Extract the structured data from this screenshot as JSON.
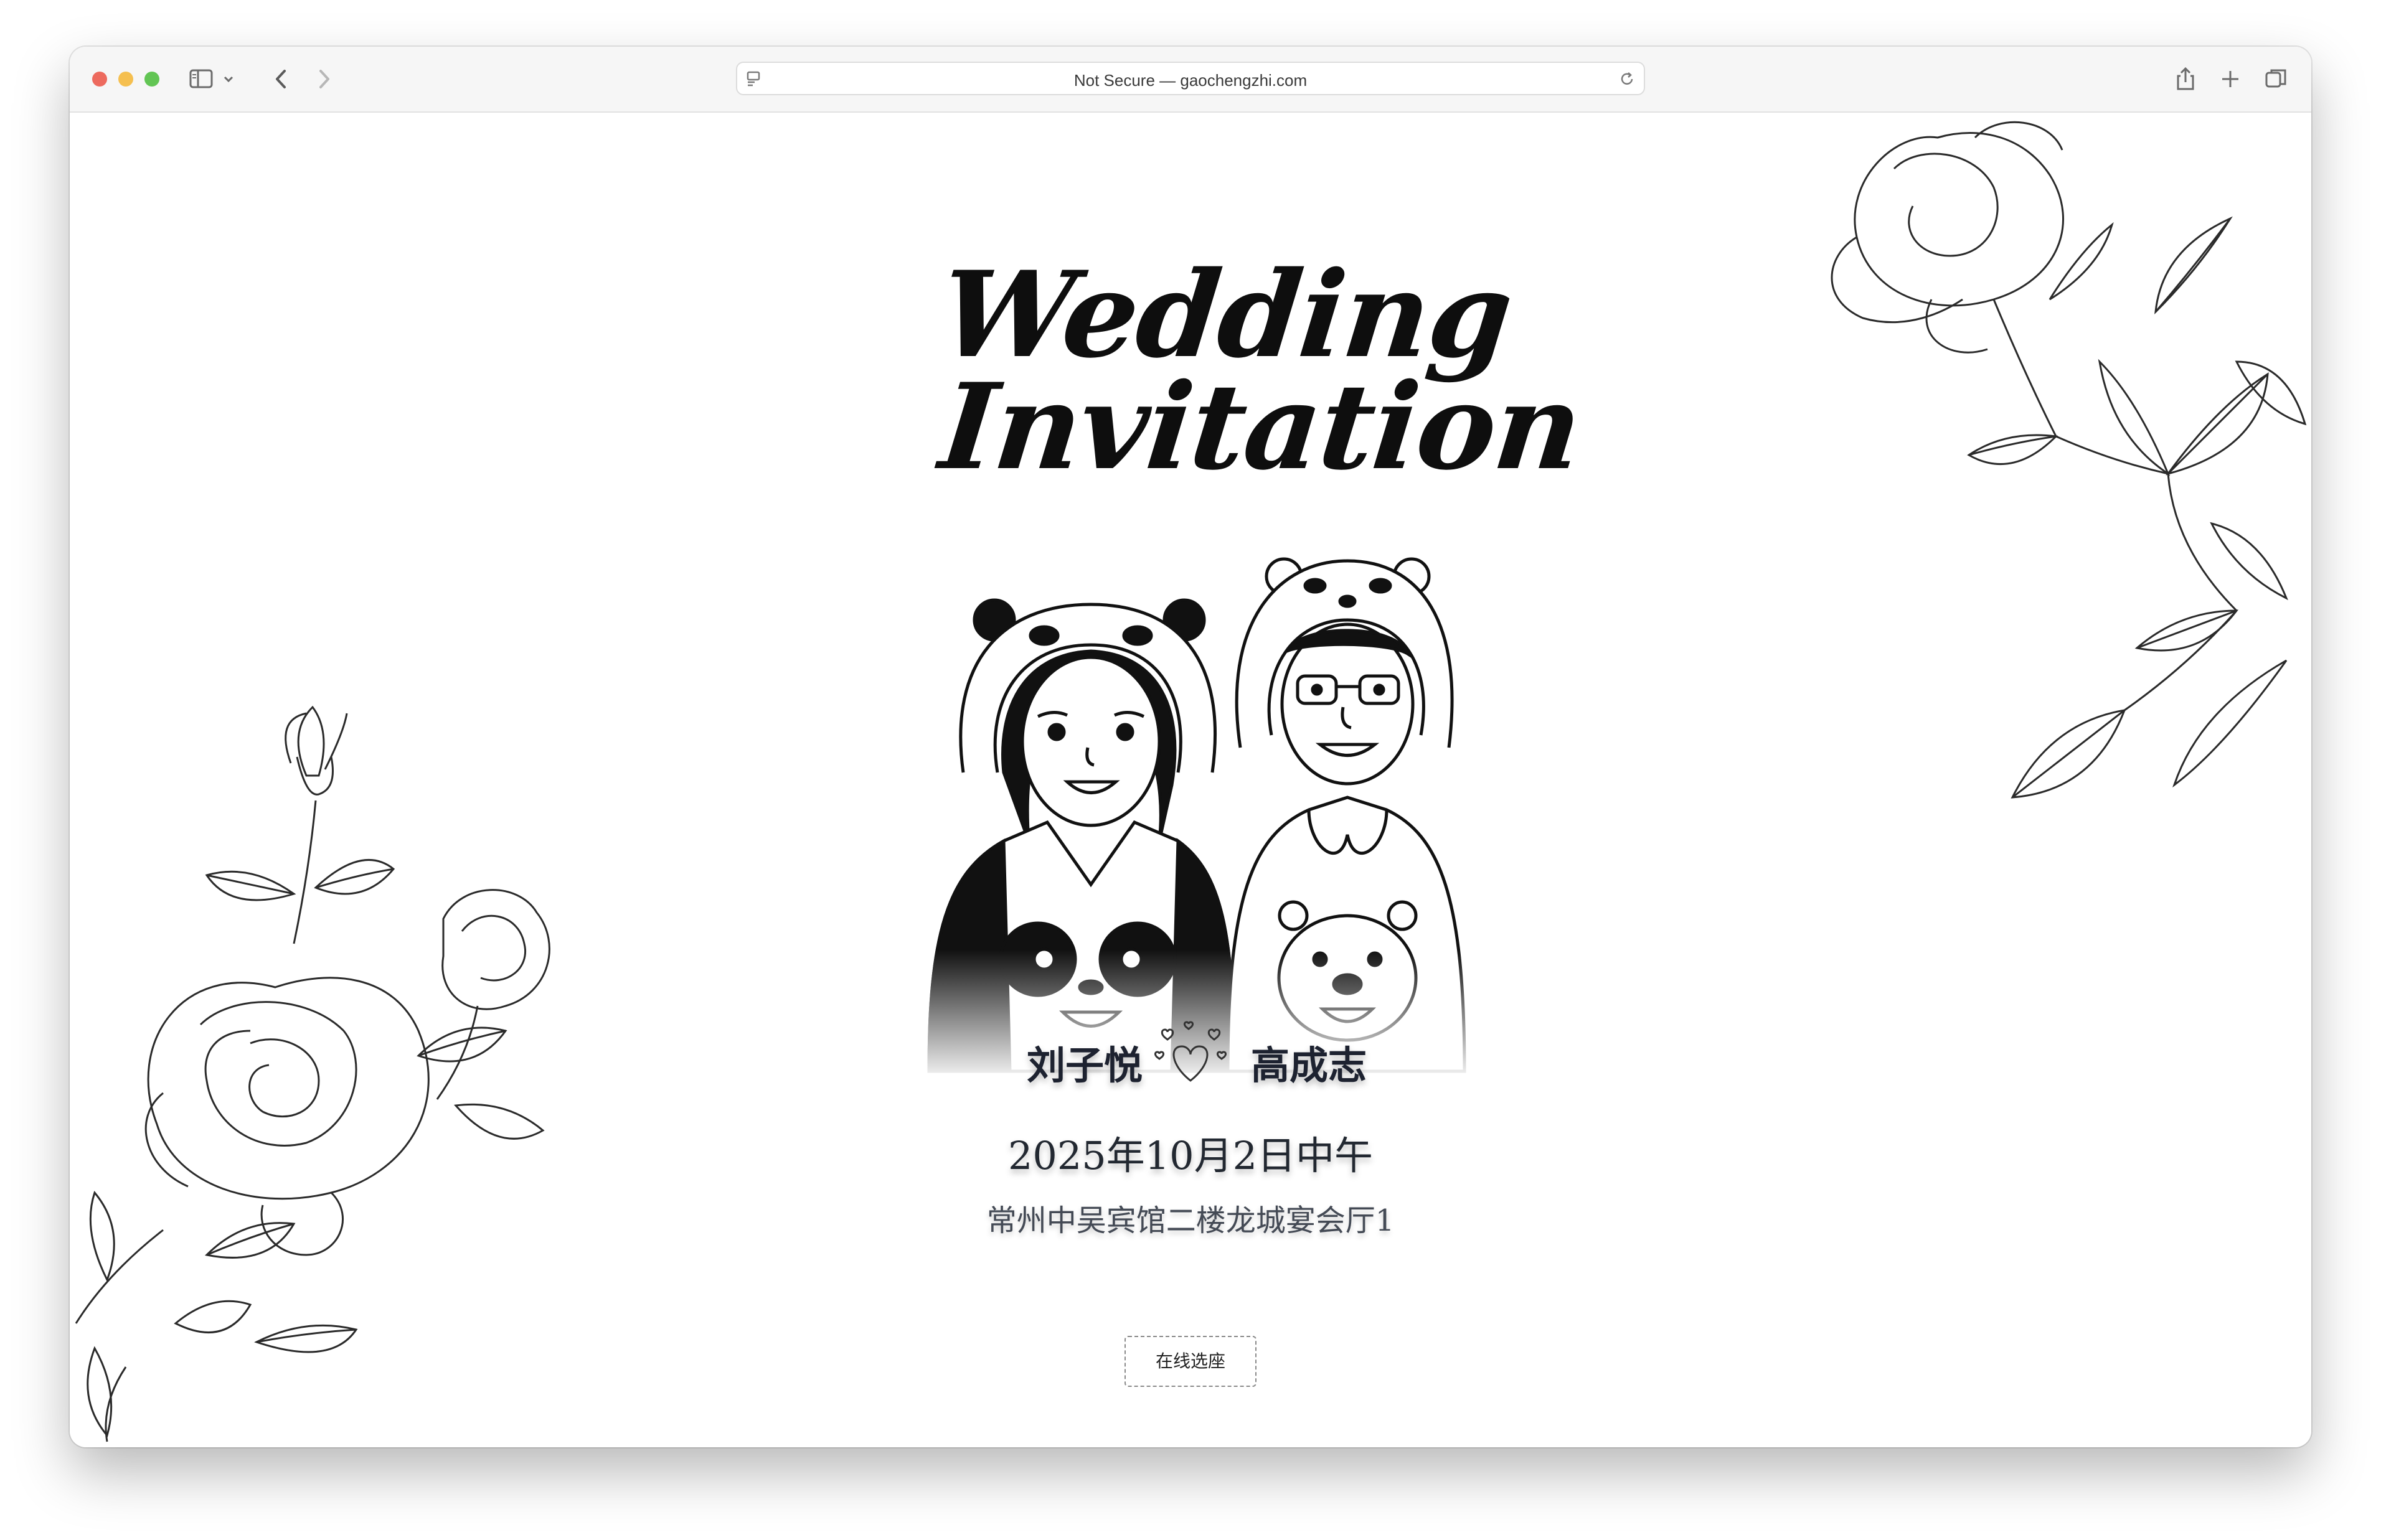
{
  "browser": {
    "address": "Not Secure — gaochengzhi.com",
    "traffic_lights": [
      "#ed6a5e",
      "#f5bf4f",
      "#62c554"
    ],
    "icons": [
      "sidebar-icon",
      "chevron-down-icon",
      "back-arrow-icon",
      "forward-arrow-icon",
      "reader-icon",
      "reload-icon",
      "share-icon",
      "new-tab-icon",
      "tab-overview-icon"
    ]
  },
  "invitation": {
    "title_line1": "Wedding",
    "title_line2": "Invitation",
    "bride": "刘子悦",
    "groom": "高成志",
    "date": "2025年10月2日中午",
    "venue": "常州中吴宾馆二楼龙城宴会厅1",
    "seat_button": "在线选座"
  }
}
